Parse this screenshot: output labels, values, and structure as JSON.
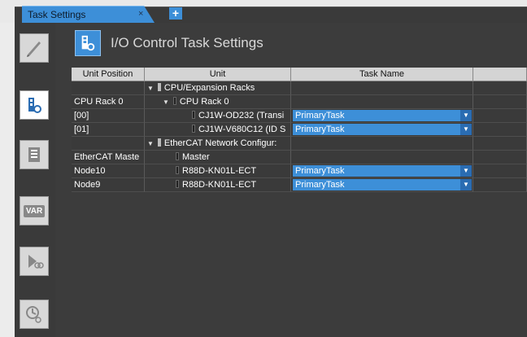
{
  "tab": {
    "label": "Task Settings",
    "close": "×",
    "add": "+"
  },
  "header": {
    "title": "I/O Control Task Settings"
  },
  "sidebar": {
    "items": [
      {
        "name": "edit"
      },
      {
        "name": "io-control"
      },
      {
        "name": "list"
      },
      {
        "name": "var",
        "label": "VAR"
      },
      {
        "name": "program-assign"
      },
      {
        "name": "task-timing"
      }
    ]
  },
  "table": {
    "columns": [
      "Unit Position",
      "Unit",
      "Task Name",
      ""
    ],
    "rows": [
      {
        "position": "",
        "unit": "CPU/Expansion Racks",
        "task": "",
        "level": "group"
      },
      {
        "position": "CPU Rack 0",
        "unit": "CPU Rack 0",
        "task": "",
        "level": "rack"
      },
      {
        "position": "[00]",
        "unit": "CJ1W-OD232 (Transi",
        "task": "PrimaryTask",
        "level": "unit"
      },
      {
        "position": "[01]",
        "unit": "CJ1W-V680C12 (ID S",
        "task": "PrimaryTask",
        "level": "unit"
      },
      {
        "position": "",
        "unit": "EtherCAT Network Configur:",
        "task": "",
        "level": "group"
      },
      {
        "position": "EtherCAT Maste",
        "unit": "Master",
        "task": "",
        "level": "master"
      },
      {
        "position": "Node10",
        "unit": "R88D-KN01L-ECT",
        "task": "PrimaryTask",
        "level": "node"
      },
      {
        "position": "Node9",
        "unit": "R88D-KN01L-ECT",
        "task": "PrimaryTask",
        "level": "node"
      }
    ]
  }
}
